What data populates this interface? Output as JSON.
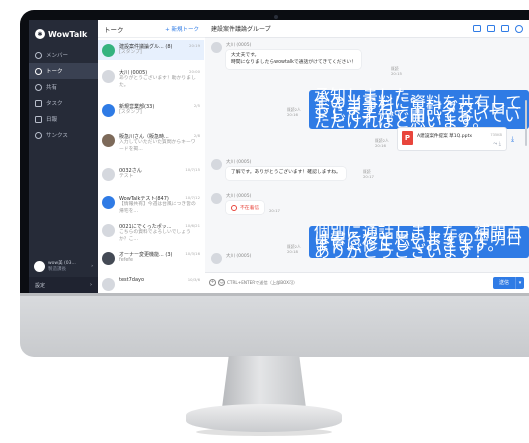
{
  "app": {
    "name": "WowTalk"
  },
  "sidebar": {
    "items": [
      {
        "label": "メンバー",
        "icon": "user-icon"
      },
      {
        "label": "トーク",
        "icon": "chat-icon",
        "active": true
      },
      {
        "label": "共有",
        "icon": "share-icon"
      },
      {
        "label": "タスク",
        "icon": "task-icon"
      },
      {
        "label": "日報",
        "icon": "report-icon"
      },
      {
        "label": "サンクス",
        "icon": "thanks-icon"
      }
    ],
    "user": {
      "name": "wow美 (03...",
      "sub": "製造課長"
    },
    "settings_label": "設定"
  },
  "talklist": {
    "title": "トーク",
    "new_label": "+ 新規トーク",
    "rows": [
      {
        "name": "建設案件議論グル...",
        "count": "(8)",
        "time": "20:19",
        "preview": "[スタンプ]"
      },
      {
        "name": "大川 (0005)",
        "time": "20:00",
        "preview": "ありがとうございます！助かりました。"
      },
      {
        "name": "新規営業部(33)",
        "time": "2/5",
        "preview": "[スタンプ]"
      },
      {
        "name": "販急川さん（販急時...",
        "time": "2/8",
        "preview": "入力していただいた質問からキーワードを掲..."
      },
      {
        "name": "0032さん",
        "time": "10/7/15",
        "preview": "テスト"
      },
      {
        "name": "WowTalkテスト(847)",
        "time": "10/7/12",
        "preview": "【情報共有】今週は台風につき皆の帰宅を..."
      },
      {
        "name": "0021にでくったポッ...",
        "time": "10/6/21",
        "preview": "こちらの資料でよろしいでしょうか？こ..."
      },
      {
        "name": "オーナー変更機能...",
        "count": "(3)",
        "time": "10/3/16",
        "preview": "fefefe"
      },
      {
        "name": "test7dayo",
        "time": "10/3/6",
        "preview": ""
      }
    ]
  },
  "chat": {
    "title": "建設案件議論グループ",
    "messages": [
      {
        "sender": "大川 (0005)",
        "text": "大丈夫です。\n時間になりましたらwowtalkで通話がけてきてください！",
        "read": "既読",
        "time": "20:15"
      },
      {
        "text": "承知しました。\n全の当事料に資料を共有しておきますね。下記ダウンロードして手元で開いておいていただければと思います。",
        "read": "既読2人",
        "time": "20:16"
      },
      {
        "file_name": "A建設案件提案 草1Q.pptx",
        "file_size": "735KB",
        "read": "既読2人",
        "time": "20:16"
      },
      {
        "sender": "大川 (0005)",
        "text": "了解です。ありがとうございます！確認しますね。",
        "read": "既読",
        "time": "20:17"
      },
      {
        "sender": "大川 (0005)",
        "text": "不在着信",
        "time": "20:17"
      },
      {
        "text": "個別に通話しました。補問点は書るだと思いますので明日までに修正しておきます。\nありがとうございます！",
        "read": "既読2人",
        "time": "20:18"
      },
      {
        "sender": "大川 (0005)"
      }
    ],
    "compose": {
      "placeholder": "CTRL+ENTERで送信（上部BOX可）",
      "send_label": "送信"
    }
  },
  "colors": {
    "accent": "#2f7be5",
    "sidebar": "#262b38",
    "missed_call": "#e8453c"
  }
}
